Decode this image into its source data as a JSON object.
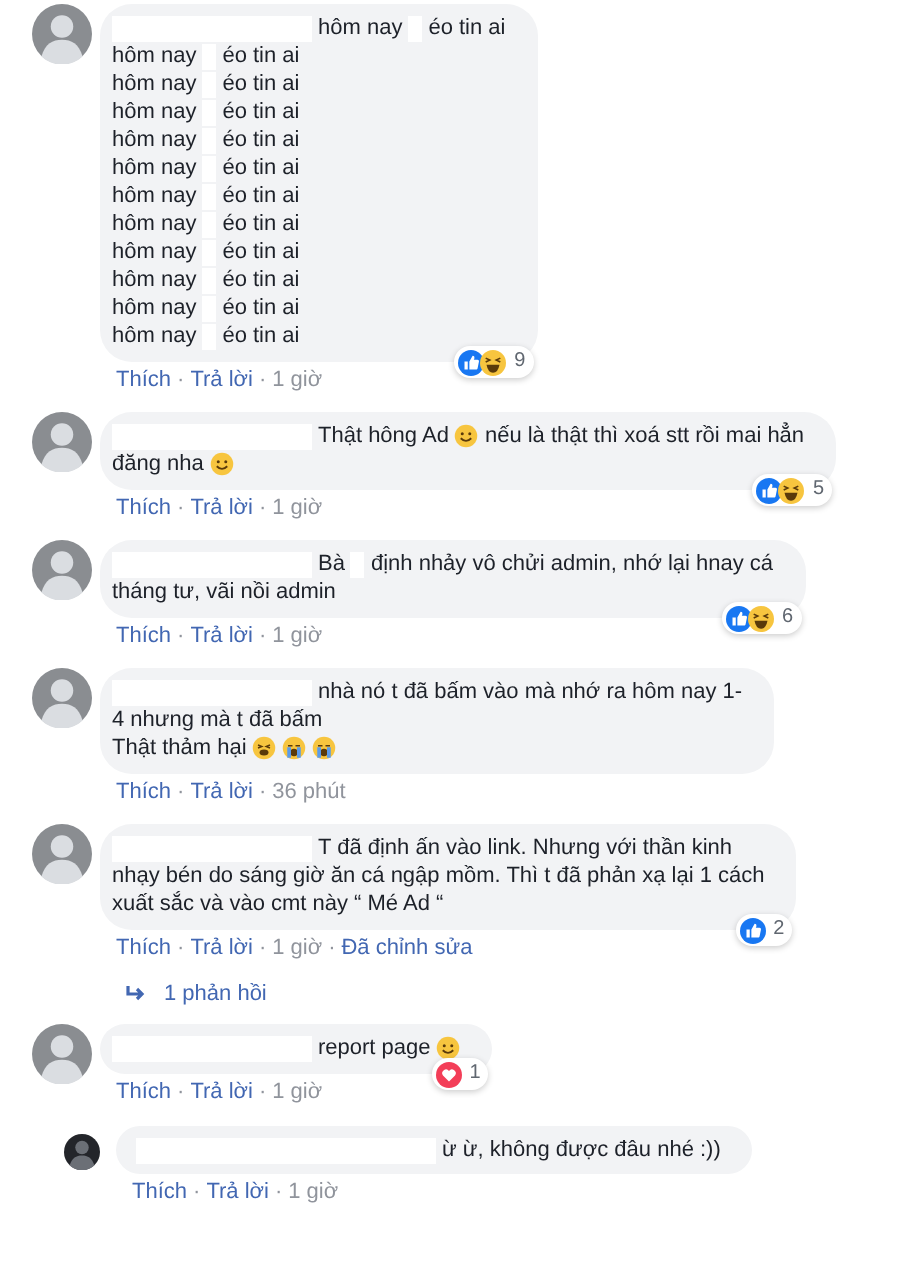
{
  "comments": [
    {
      "lines": [
        [
          {
            "kind": "name-redaction"
          },
          {
            "kind": "text",
            "text": "hôm nay"
          },
          {
            "kind": "word-redaction"
          },
          {
            "kind": "text",
            "text": "éo tin ai"
          }
        ],
        [
          {
            "kind": "text",
            "text": "hôm nay"
          },
          {
            "kind": "word-redaction"
          },
          {
            "kind": "text",
            "text": "éo tin ai"
          }
        ],
        [
          {
            "kind": "text",
            "text": "hôm nay"
          },
          {
            "kind": "word-redaction"
          },
          {
            "kind": "text",
            "text": "éo tin ai"
          }
        ],
        [
          {
            "kind": "text",
            "text": "hôm nay"
          },
          {
            "kind": "word-redaction"
          },
          {
            "kind": "text",
            "text": "éo tin ai"
          }
        ],
        [
          {
            "kind": "text",
            "text": "hôm nay"
          },
          {
            "kind": "word-redaction"
          },
          {
            "kind": "text",
            "text": "éo tin ai"
          }
        ],
        [
          {
            "kind": "text",
            "text": "hôm nay"
          },
          {
            "kind": "word-redaction"
          },
          {
            "kind": "text",
            "text": "éo tin ai"
          }
        ],
        [
          {
            "kind": "text",
            "text": "hôm nay"
          },
          {
            "kind": "word-redaction"
          },
          {
            "kind": "text",
            "text": "éo tin ai"
          }
        ],
        [
          {
            "kind": "text",
            "text": "hôm nay"
          },
          {
            "kind": "word-redaction"
          },
          {
            "kind": "text",
            "text": "éo tin ai"
          }
        ],
        [
          {
            "kind": "text",
            "text": "hôm nay"
          },
          {
            "kind": "word-redaction"
          },
          {
            "kind": "text",
            "text": "éo tin ai"
          }
        ],
        [
          {
            "kind": "text",
            "text": "hôm nay"
          },
          {
            "kind": "word-redaction"
          },
          {
            "kind": "text",
            "text": "éo tin ai"
          }
        ],
        [
          {
            "kind": "text",
            "text": "hôm nay"
          },
          {
            "kind": "word-redaction"
          },
          {
            "kind": "text",
            "text": "éo tin ai"
          }
        ],
        [
          {
            "kind": "text",
            "text": "hôm nay"
          },
          {
            "kind": "word-redaction"
          },
          {
            "kind": "text",
            "text": "éo tin ai"
          }
        ]
      ],
      "reactions": [
        {
          "kind": "like"
        },
        {
          "kind": "haha"
        }
      ],
      "reaction_count": "9",
      "actions": [
        {
          "kind": "link",
          "text": "Thích"
        },
        {
          "kind": "separator",
          "text": "·"
        },
        {
          "kind": "link",
          "text": "Trả lời"
        },
        {
          "kind": "separator",
          "text": "·"
        },
        {
          "kind": "meta",
          "text": "1 giờ"
        }
      ]
    },
    {
      "lines": [
        [
          {
            "kind": "name-redaction"
          },
          {
            "kind": "text",
            "text": "Thật hông Ad"
          },
          {
            "kind": "smile-emoji"
          },
          {
            "kind": "text",
            "text": "nếu là thật thì xoá stt rồi mai hẳn"
          }
        ],
        [
          {
            "kind": "text",
            "text": "đăng nha"
          },
          {
            "kind": "smile-emoji"
          }
        ]
      ],
      "reactions": [
        {
          "kind": "like"
        },
        {
          "kind": "haha"
        }
      ],
      "reaction_count": "5",
      "actions": [
        {
          "kind": "link",
          "text": "Thích"
        },
        {
          "kind": "separator",
          "text": "·"
        },
        {
          "kind": "link",
          "text": "Trả lời"
        },
        {
          "kind": "separator",
          "text": "·"
        },
        {
          "kind": "meta",
          "text": "1 giờ"
        }
      ]
    },
    {
      "lines": [
        [
          {
            "kind": "name-redaction"
          },
          {
            "kind": "text",
            "text": "Bà"
          },
          {
            "kind": "word-redaction"
          },
          {
            "kind": "text",
            "text": "định nhảy vô chửi admin, nhớ lại hnay cá"
          }
        ],
        [
          {
            "kind": "text",
            "text": "tháng tư, vãi nồi admin"
          }
        ]
      ],
      "reactions": [
        {
          "kind": "like"
        },
        {
          "kind": "haha"
        }
      ],
      "reaction_count": "6",
      "actions": [
        {
          "kind": "link",
          "text": "Thích"
        },
        {
          "kind": "separator",
          "text": "·"
        },
        {
          "kind": "link",
          "text": "Trả lời"
        },
        {
          "kind": "separator",
          "text": "·"
        },
        {
          "kind": "meta",
          "text": "1 giờ"
        }
      ]
    },
    {
      "lines": [
        [
          {
            "kind": "name-redaction"
          },
          {
            "kind": "text",
            "text": "nhà nó t đã bấm vào mà nhớ ra hôm nay 1-"
          }
        ],
        [
          {
            "kind": "text",
            "text": "4 nhưng mà t đã bấm"
          }
        ],
        [
          {
            "kind": "text",
            "text": "Thật thảm hại"
          },
          {
            "kind": "tired-emoji"
          },
          {
            "kind": "crying-emoji"
          },
          {
            "kind": "crying-emoji"
          }
        ]
      ],
      "actions": [
        {
          "kind": "link",
          "text": "Thích"
        },
        {
          "kind": "separator",
          "text": "·"
        },
        {
          "kind": "link",
          "text": "Trả lời"
        },
        {
          "kind": "separator",
          "text": "·"
        },
        {
          "kind": "meta",
          "text": "36 phút"
        }
      ]
    },
    {
      "lines": [
        [
          {
            "kind": "name-redaction"
          },
          {
            "kind": "text",
            "text": "T đã định ấn vào link. Nhưng với thần kinh"
          }
        ],
        [
          {
            "kind": "text",
            "text": "nhạy bén do sáng giờ ăn cá ngập mồm. Thì t đã phản xạ lại 1 cách"
          }
        ],
        [
          {
            "kind": "text",
            "text": "xuất sắc và vào cmt này “ Mé Ad “"
          }
        ]
      ],
      "reactions": [
        {
          "kind": "like"
        }
      ],
      "reaction_count": "2",
      "actions": [
        {
          "kind": "link",
          "text": "Thích"
        },
        {
          "kind": "separator",
          "text": "·"
        },
        {
          "kind": "link",
          "text": "Trả lời"
        },
        {
          "kind": "separator",
          "text": "·"
        },
        {
          "kind": "meta",
          "text": "1 giờ"
        },
        {
          "kind": "separator",
          "text": "·"
        },
        {
          "kind": "link",
          "text": "Đã chỉnh sửa"
        }
      ],
      "replies_link": "1 phản hồi"
    },
    {
      "lines": [
        [
          {
            "kind": "name-redaction"
          },
          {
            "kind": "text",
            "text": "report page"
          },
          {
            "kind": "smile-emoji"
          }
        ]
      ],
      "reactions": [
        {
          "kind": "love"
        }
      ],
      "reaction_count": "1",
      "actions": [
        {
          "kind": "link",
          "text": "Thích"
        },
        {
          "kind": "separator",
          "text": "·"
        },
        {
          "kind": "link",
          "text": "Trả lời"
        },
        {
          "kind": "separator",
          "text": "·"
        },
        {
          "kind": "meta",
          "text": "1 giờ"
        }
      ],
      "replies": [
        {
          "lines": [
            [
              {
                "kind": "long-name-redaction"
              },
              {
                "kind": "text",
                "text": "ừ ừ, không được đâu nhé :))"
              }
            ]
          ],
          "actions": [
            {
              "kind": "link",
              "text": "Thích"
            },
            {
              "kind": "separator",
              "text": "·"
            },
            {
              "kind": "link",
              "text": "Trả lời"
            },
            {
              "kind": "separator",
              "text": "·"
            },
            {
              "kind": "meta",
              "text": "1 giờ"
            }
          ]
        }
      ]
    }
  ]
}
